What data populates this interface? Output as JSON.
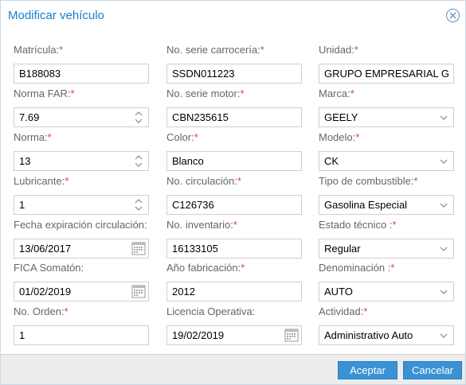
{
  "dialog": {
    "title": "Modificar vehículo"
  },
  "fields": {
    "matricula": {
      "label": "Matrícula:",
      "required": "*",
      "value": "B188083"
    },
    "no_serie_carroceria": {
      "label": "No. serie carrocería:",
      "required": "*",
      "value": "SSDN011223"
    },
    "unidad": {
      "label": "Unidad:",
      "required": "*",
      "value": "GRUPO EMPRESARIAL G"
    },
    "norma_far": {
      "label": "Norma FAR:",
      "required": "*",
      "value": "7.69"
    },
    "no_serie_motor": {
      "label": "No. serie motor:",
      "required": "*",
      "value": "CBN235615"
    },
    "marca": {
      "label": "Marca:",
      "required": "*",
      "value": "GEELY"
    },
    "norma": {
      "label": "Norma:",
      "required": "*",
      "value": "13"
    },
    "color": {
      "label": "Color:",
      "required": "*",
      "value": "Blanco"
    },
    "modelo": {
      "label": "Modelo:",
      "required": "*",
      "value": "CK"
    },
    "lubricante": {
      "label": "Lubricante:",
      "required": "*",
      "value": "1"
    },
    "no_circulacion": {
      "label": "No. circulación:",
      "required": "*",
      "value": "C126736"
    },
    "tipo_combustible": {
      "label": "Tipo de combustible:",
      "required": "*",
      "value": "Gasolina Especial"
    },
    "fecha_expiracion": {
      "label": "Fecha expiración  circulación:",
      "required": "",
      "value": "13/06/2017"
    },
    "no_inventario": {
      "label": "No. inventario:",
      "required": "*",
      "value": "16133105"
    },
    "estado_tecnico": {
      "label": "Estado técnico :",
      "required": "*",
      "value": "Regular"
    },
    "fica_somaton": {
      "label": "FICA Somatón:",
      "required": "",
      "value": "01/02/2019"
    },
    "anio_fabricacion": {
      "label": "Año fabricación:",
      "required": "*",
      "value": "2012"
    },
    "denominacion": {
      "label": "Denominación :",
      "required": "*",
      "value": "AUTO"
    },
    "no_orden": {
      "label": "No. Orden:",
      "required": "*",
      "value": "1"
    },
    "licencia_operativa": {
      "label": "Licencia Operativa:",
      "required": "",
      "value": "19/02/2019"
    },
    "actividad": {
      "label": "Actividad:",
      "required": "*",
      "value": "Administrativo Auto"
    }
  },
  "footer": {
    "accept_label": "Aceptar",
    "cancel_label": "Cancelar"
  },
  "colors": {
    "title": "#157fcc",
    "required": "#cf4c35",
    "button": "#3892d4"
  },
  "icons": {
    "close": "close-circle-icon",
    "spinner": "spinner-arrows-icon",
    "calendar": "calendar-icon",
    "combo": "chevron-down-icon"
  }
}
